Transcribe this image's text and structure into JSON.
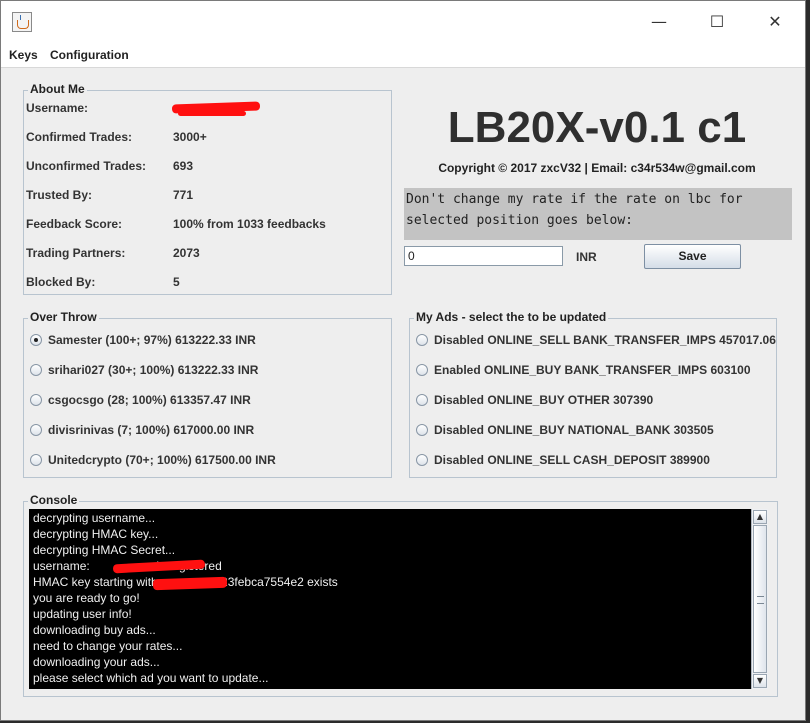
{
  "menu": {
    "items": [
      "Keys",
      "Configuration"
    ]
  },
  "about": {
    "title": "About Me",
    "rows": [
      {
        "label": "Username:",
        "value": ""
      },
      {
        "label": "Confirmed Trades:",
        "value": "3000+"
      },
      {
        "label": "Unconfirmed Trades:",
        "value": "693"
      },
      {
        "label": "Trusted By:",
        "value": "771"
      },
      {
        "label": "Feedback Score:",
        "value": "100% from 1033 feedbacks"
      },
      {
        "label": "Trading Partners:",
        "value": "2073"
      },
      {
        "label": "Blocked By:",
        "value": "5"
      }
    ]
  },
  "header": {
    "title": "LB20X-v0.1 c1",
    "copyright": "Copyright © 2017 zxcV32 | Email: c34r534w@gmail.com",
    "warning": "Don't change my rate if the rate on lbc for selected position goes below:"
  },
  "rate": {
    "value": "0",
    "currency": "INR",
    "save_label": "Save"
  },
  "overthrow": {
    "title": "Over Throw",
    "options": [
      {
        "label": "Samester (100+; 97%) 613222.33 INR",
        "selected": true
      },
      {
        "label": "srihari027 (30+; 100%) 613222.33 INR",
        "selected": false
      },
      {
        "label": "csgocsgo (28; 100%) 613357.47 INR",
        "selected": false
      },
      {
        "label": "divisrinivas (7; 100%) 617000.00 INR",
        "selected": false
      },
      {
        "label": "Unitedcrypto (70+; 100%) 617500.00 INR",
        "selected": false
      }
    ]
  },
  "myads": {
    "title": "My Ads - select the to be updated",
    "options": [
      {
        "label": "Disabled  ONLINE_SELL BANK_TRANSFER_IMPS 457017.06",
        "selected": false
      },
      {
        "label": "Enabled  ONLINE_BUY BANK_TRANSFER_IMPS 603100",
        "selected": false
      },
      {
        "label": "Disabled  ONLINE_BUY OTHER 307390",
        "selected": false
      },
      {
        "label": "Disabled  ONLINE_BUY NATIONAL_BANK 303505",
        "selected": false
      },
      {
        "label": "Disabled  ONLINE_SELL CASH_DEPOSIT 389900",
        "selected": false
      }
    ]
  },
  "console": {
    "title": "Console",
    "lines": [
      "decrypting username...",
      "decrypting HMAC key...",
      "decrypting HMAC Secret...",
      "username:                    is registered",
      "HMAC key starting with                   23febca7554e2 exists",
      "you are ready to go!",
      "updating user info!",
      "downloading buy ads...",
      "need to change your rates...",
      "downloading your ads...",
      "please select which ad you want to update..."
    ]
  },
  "colors": {
    "redaction": "#ff1010",
    "console_bg": "#000000",
    "console_text": "#f0f0f0"
  }
}
